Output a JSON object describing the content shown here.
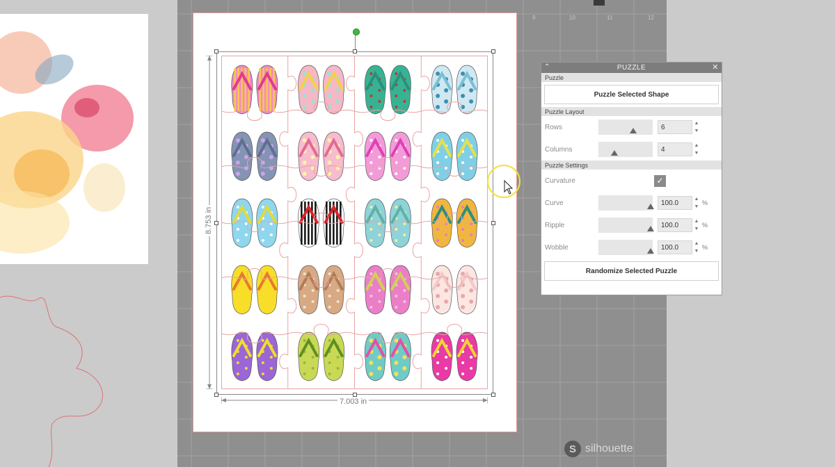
{
  "mat": {
    "brand_name": "silhouette",
    "brand_mark": "S",
    "ruler_numbers": [
      "9",
      "10",
      "11",
      "12"
    ]
  },
  "design": {
    "width_label": "7.003 in",
    "height_label": "8.753 in"
  },
  "panel": {
    "title": "PUZZLE",
    "section_puzzle": "Puzzle",
    "puzzle_button": "Puzzle Selected Shape",
    "section_layout": "Puzzle Layout",
    "rows_label": "Rows",
    "rows_value": "6",
    "rows_slider_fraction": 0.6,
    "columns_label": "Columns",
    "columns_value": "4",
    "columns_slider_fraction": 0.25,
    "section_settings": "Puzzle Settings",
    "curvature_label": "Curvature",
    "curvature_checked": true,
    "curve_label": "Curve",
    "curve_value": "100.0",
    "ripple_label": "Ripple",
    "ripple_value": "100.0",
    "wobble_label": "Wobble",
    "wobble_value": "100.0",
    "percent_unit": "%",
    "randomize_button": "Randomize Selected Puzzle"
  },
  "colors": {
    "panel_title_bg": "#7d7d7d",
    "mat": "#8f8f8f",
    "selection_green": "#3dbb3d"
  },
  "flipflops": [
    {
      "strap": "#e23a8e",
      "sole": "#f18bc2",
      "pattern": "stripe",
      "alt": "#f8c94b"
    },
    {
      "strap": "#f2d24a",
      "sole": "#f6b7c6",
      "pattern": "flower",
      "alt": "#9fe0d2"
    },
    {
      "strap": "#2b8f7a",
      "sole": "#37b394",
      "pattern": "dots",
      "alt": "#c0392b"
    },
    {
      "strap": "#7ac0d4",
      "sole": "#cfe8f1",
      "pattern": "flower",
      "alt": "#3d8fb0"
    },
    {
      "strap": "#5e6f8f",
      "sole": "#8593b5",
      "pattern": "flower",
      "alt": "#c8a6e8"
    },
    {
      "strap": "#e26a96",
      "sole": "#f7bccd",
      "pattern": "flower",
      "alt": "#fff2a6"
    },
    {
      "strap": "#e040b5",
      "sole": "#f39bd8",
      "pattern": "dots",
      "alt": "#ffffff"
    },
    {
      "strap": "#e5e04b",
      "sole": "#7fd0e6",
      "pattern": "dots",
      "alt": "#ffffff"
    },
    {
      "strap": "#e0da3f",
      "sole": "#8fd7ef",
      "pattern": "dots",
      "alt": "#ffffff"
    },
    {
      "strap": "#d8232a",
      "sole": "#ffffff",
      "pattern": "stripe",
      "alt": "#111111"
    },
    {
      "strap": "#5fb1a8",
      "sole": "#8ed3d8",
      "pattern": "dots",
      "alt": "#f3f0a0"
    },
    {
      "strap": "#2f8f7d",
      "sole": "#f1b640",
      "pattern": "dots",
      "alt": "#e67cc4"
    },
    {
      "strap": "#e87a2c",
      "sole": "#f8de29",
      "pattern": "plain",
      "alt": "#f8de29"
    },
    {
      "strap": "#b07c56",
      "sole": "#d7aa83",
      "pattern": "dots",
      "alt": "#f5e2cf"
    },
    {
      "strap": "#cfd24d",
      "sole": "#ea7fc7",
      "pattern": "dots",
      "alt": "#f5c2e6"
    },
    {
      "strap": "#f3c8c8",
      "sole": "#fbe6e2",
      "pattern": "flower",
      "alt": "#e8a8a8"
    },
    {
      "strap": "#f0dc30",
      "sole": "#9b66d6",
      "pattern": "dots",
      "alt": "#f0dc30"
    },
    {
      "strap": "#5f8f22",
      "sole": "#c9d955",
      "pattern": "dots",
      "alt": "#9bb63a"
    },
    {
      "strap": "#e44fa6",
      "sole": "#6fcbc7",
      "pattern": "flower",
      "alt": "#f6e24c"
    },
    {
      "strap": "#f2d430",
      "sole": "#e93aa5",
      "pattern": "dots",
      "alt": "#ffffff"
    }
  ]
}
